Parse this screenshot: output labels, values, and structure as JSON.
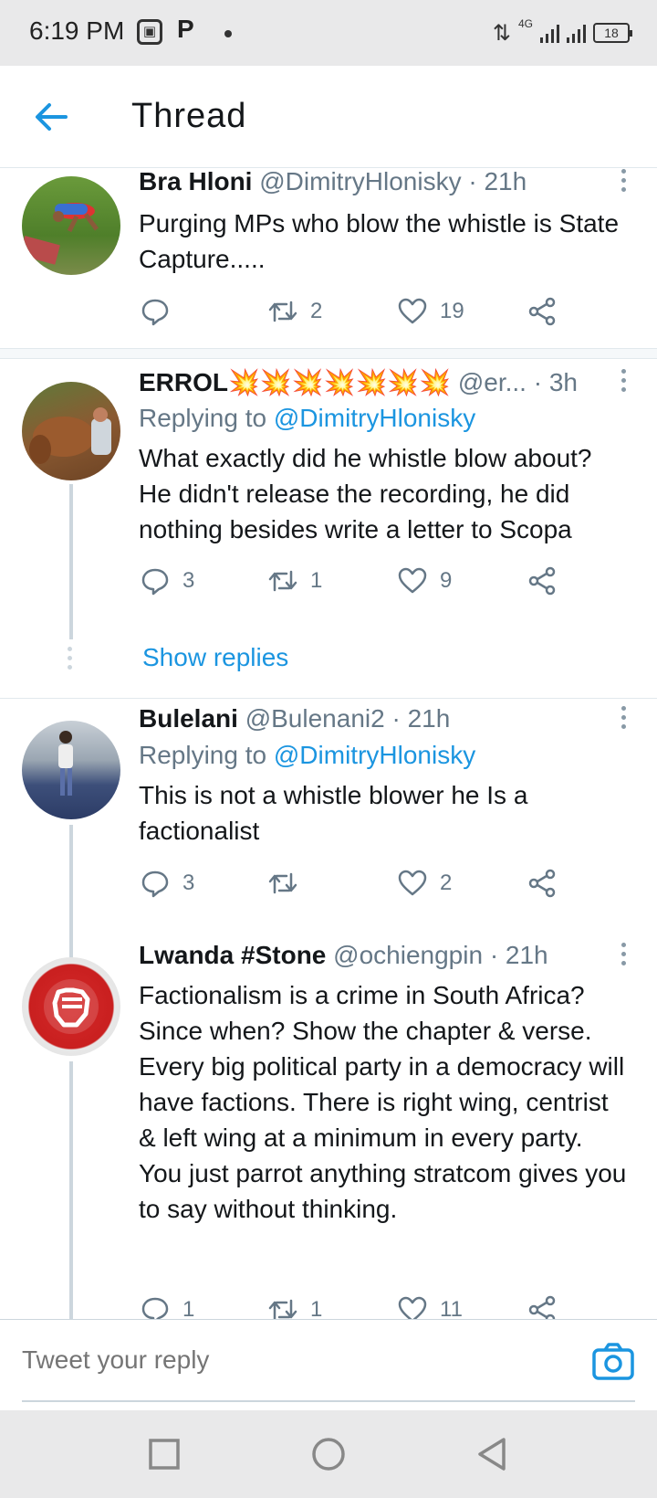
{
  "status_bar": {
    "time": "6:19 PM",
    "app_icon_text": "P",
    "network": "4G",
    "battery": "18"
  },
  "header": {
    "title": "Thread",
    "back_icon": "arrow-left-icon"
  },
  "tweets": [
    {
      "name": "Bra Hloni",
      "handle": "@DimitryHlonisky",
      "time": "· 21h",
      "text": "Purging MPs who blow the whistle is State Capture.....",
      "replies": "",
      "retweets": "2",
      "likes": "19"
    },
    {
      "name": "ERROL💥💥💥💥💥💥💥",
      "handle": "@er...",
      "time": "· 3h",
      "replying_label": "Replying to",
      "replying_to": "@DimitryHlonisky",
      "text": "What exactly did he whistle blow about? He didn't release the recording, he did nothing besides write a letter to Scopa",
      "replies": "3",
      "retweets": "1",
      "likes": "9",
      "show_replies": "Show replies"
    },
    {
      "name": "Bulelani",
      "handle": "@Bulenani2",
      "time": "· 21h",
      "replying_label": "Replying to",
      "replying_to": "@DimitryHlonisky",
      "text": "This  is not a whistle blower  he Is a factionalist",
      "replies": "3",
      "retweets": "",
      "likes": "2"
    },
    {
      "name": "Lwanda #Stone",
      "handle": "@ochiengpin",
      "time": "· 21h",
      "text": "Factionalism is a crime in South Africa? Since when? Show the chapter & verse. Every big political party in a democracy will have factions. There is right wing, centrist & left wing at a minimum in every party. You just parrot anything stratcom gives you to say without thinking.",
      "replies": "1",
      "retweets": "1",
      "likes": "11"
    }
  ],
  "reply_bar": {
    "placeholder": "Tweet your reply",
    "camera_icon": "camera-icon"
  },
  "colors": {
    "accent": "#1b95e0",
    "secondary_text": "#657786",
    "divider": "#e1e8ed"
  }
}
